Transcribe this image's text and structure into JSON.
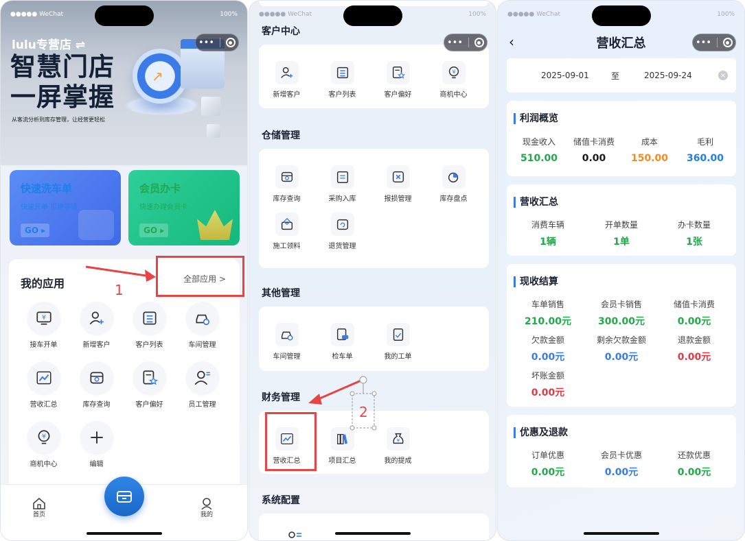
{
  "status": {
    "carrier": "●●●●● WeChat",
    "battery": "100%"
  },
  "phone1": {
    "store_name": "lulu专营店 ⇌",
    "headline1": "智慧门店",
    "headline2": "一屏掌握",
    "subline": "从客流分析到库存管理，让经营更轻松",
    "quick_wash": {
      "title": "快速洗车单",
      "sub": "快速开单 拒绝等待",
      "go": "GO ▸"
    },
    "quick_member": {
      "title": "会员办卡",
      "sub": "快速办理会员卡",
      "go": "GO ▸"
    },
    "my_apps_title": "我的应用",
    "all_apps": "全部应用 >",
    "annotation_1": "1",
    "apps": [
      {
        "label": "接车开单",
        "icon": "yen-monitor-icon"
      },
      {
        "label": "新增客户",
        "icon": "add-user-icon"
      },
      {
        "label": "客户列表",
        "icon": "list-icon"
      },
      {
        "label": "车间管理",
        "icon": "car-gear-icon"
      },
      {
        "label": "营收汇总",
        "icon": "chart-icon"
      },
      {
        "label": "库存查询",
        "icon": "inventory-search-icon"
      },
      {
        "label": "客户偏好",
        "icon": "star-doc-icon"
      },
      {
        "label": "员工管理",
        "icon": "staff-icon"
      },
      {
        "label": "商机中心",
        "icon": "bulb-yen-icon"
      },
      {
        "label": "编辑",
        "icon": "plus-icon"
      }
    ],
    "tabs": {
      "home": "首页",
      "me": "我的"
    }
  },
  "phone2": {
    "annotation_2": "2",
    "sections": [
      {
        "title": "客户中心",
        "items": [
          {
            "label": "新增客户",
            "icon": "add-user-icon"
          },
          {
            "label": "客户列表",
            "icon": "list-icon"
          },
          {
            "label": "客户偏好",
            "icon": "star-doc-icon"
          },
          {
            "label": "商机中心",
            "icon": "bulb-yen-icon"
          }
        ]
      },
      {
        "title": "仓储管理",
        "items": [
          {
            "label": "库存查询",
            "icon": "inventory-search-icon"
          },
          {
            "label": "采购入库",
            "icon": "purchase-icon"
          },
          {
            "label": "报损管理",
            "icon": "damage-icon"
          },
          {
            "label": "库存盘点",
            "icon": "stocktake-icon"
          },
          {
            "label": "施工领料",
            "icon": "material-icon"
          },
          {
            "label": "退货管理",
            "icon": "return-icon"
          }
        ]
      },
      {
        "title": "其他管理",
        "items": [
          {
            "label": "车间管理",
            "icon": "car-gear-icon"
          },
          {
            "label": "检车单",
            "icon": "inspection-icon"
          },
          {
            "label": "我的工单",
            "icon": "workorder-icon"
          }
        ]
      },
      {
        "title": "财务管理",
        "items": [
          {
            "label": "营收汇总",
            "icon": "chart-icon"
          },
          {
            "label": "项目汇总",
            "icon": "books-icon"
          },
          {
            "label": "我的提成",
            "icon": "moneybag-icon"
          }
        ]
      },
      {
        "title": "系统配置",
        "items": []
      }
    ]
  },
  "phone3": {
    "title": "营收汇总",
    "date_start": "2025-09-01",
    "date_sep": "至",
    "date_end": "2025-09-24",
    "clear": "×",
    "profit": {
      "title": "利润概览",
      "items": [
        {
          "k": "现金收入",
          "v": "510.00"
        },
        {
          "k": "储值卡消费",
          "v": "0.00"
        },
        {
          "k": "成本",
          "v": "150.00"
        },
        {
          "k": "毛利",
          "v": "360.00"
        }
      ]
    },
    "revenue": {
      "title": "营收汇总",
      "items": [
        {
          "k": "消费车辆",
          "v": "1辆"
        },
        {
          "k": "开单数量",
          "v": "1单"
        },
        {
          "k": "办卡数量",
          "v": "1张"
        }
      ]
    },
    "settle": {
      "title": "现收结算",
      "items": [
        {
          "k": "车单销售",
          "v": "210.00元"
        },
        {
          "k": "会员卡销售",
          "v": "300.00元"
        },
        {
          "k": "储值卡消费",
          "v": "0.00元"
        },
        {
          "k": "欠款金额",
          "v": "0.00元"
        },
        {
          "k": "剩余欠款金额",
          "v": "0.00元"
        },
        {
          "k": "退款金额",
          "v": "0.00元"
        },
        {
          "k": "坏账金额",
          "v": "0.00元"
        }
      ]
    },
    "discount": {
      "title": "优惠及退款",
      "items": [
        {
          "k": "订单优惠",
          "v": "0.00元"
        },
        {
          "k": "会员卡优惠",
          "v": "0.00元"
        },
        {
          "k": "还款优惠",
          "v": "0.00元"
        }
      ]
    }
  },
  "colors": {
    "accent": "#3a7be8",
    "green": "#21a94a",
    "orange": "#f28c1f",
    "red": "#e03a44",
    "annotation": "#e64545"
  }
}
